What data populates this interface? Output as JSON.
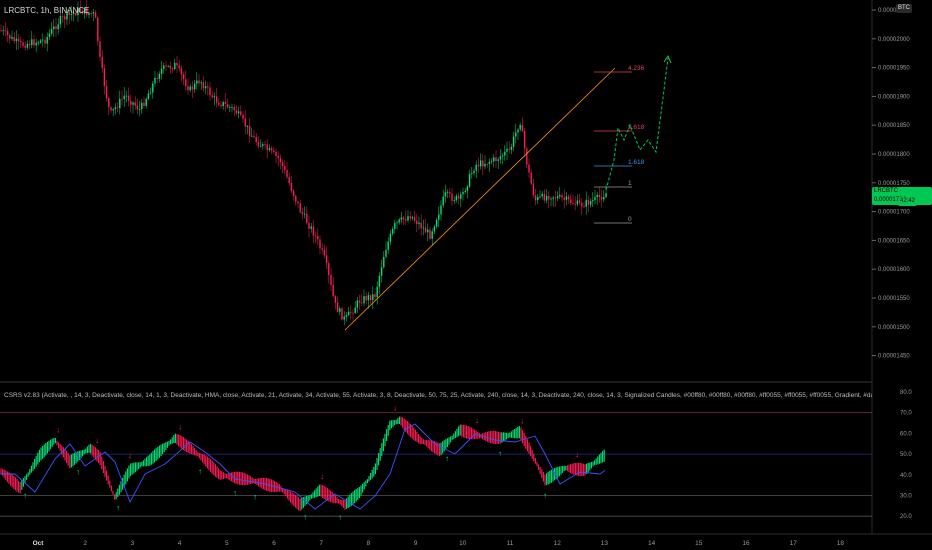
{
  "symbol": {
    "title": "LRCBTC, 1h, BINANCE"
  },
  "currency_badge": "BTC",
  "price_axis": {
    "ticks": [
      "0.00002050",
      "0.00002000",
      "0.00001950",
      "0.00001900",
      "0.00001850",
      "0.00001800",
      "0.00001750",
      "0.00001700",
      "0.00001650",
      "0.00001600",
      "0.00001550",
      "0.00001500",
      "0.00001450"
    ],
    "current_label": "LRCBTC · 0.00001734",
    "timer": "42:42"
  },
  "fib_levels": [
    {
      "label": "4.236",
      "color": "#e04060"
    },
    {
      "label": "2.618",
      "color": "#e04060"
    },
    {
      "label": "1.618",
      "color": "#4d8fe0"
    },
    {
      "label": "1",
      "color": "#9a9a9a"
    },
    {
      "label": "0",
      "color": "#9a9a9a"
    }
  ],
  "indicator": {
    "title": "CSRS v2.83 (Activate, , 14, 3, Deactivate, close, 14, 1, 3, Deactivate, HMA, close, Activate, 21, Activate, 34, Activate, 55, Activate, 3, 8, Deactivate, 50, 75, 25, Activate, 240, close, 14, 3, Deactivate, 240, close, 14, 3, Signalized Candles, #00ff80, #00ff80, #00ff80, #ff0055, #ff0055, #ff0055, Gradient, #daff00, #e5ff4d, 2, 3)",
    "axis_ticks": [
      "80.0",
      "70.0",
      "60.0",
      "50.0",
      "40.0",
      "30.0",
      "20.0"
    ]
  },
  "time_axis": {
    "ticks": [
      "Oct",
      "2",
      "3",
      "4",
      "5",
      "6",
      "7",
      "8",
      "9",
      "10",
      "11",
      "12",
      "13",
      "14",
      "15",
      "16",
      "17",
      "18"
    ]
  },
  "colors": {
    "bull": "#00e676",
    "bear": "#ff1e56",
    "fib_line": "#ff9800",
    "projection": "#00c853",
    "rsi_line": "#3f51ff"
  }
}
